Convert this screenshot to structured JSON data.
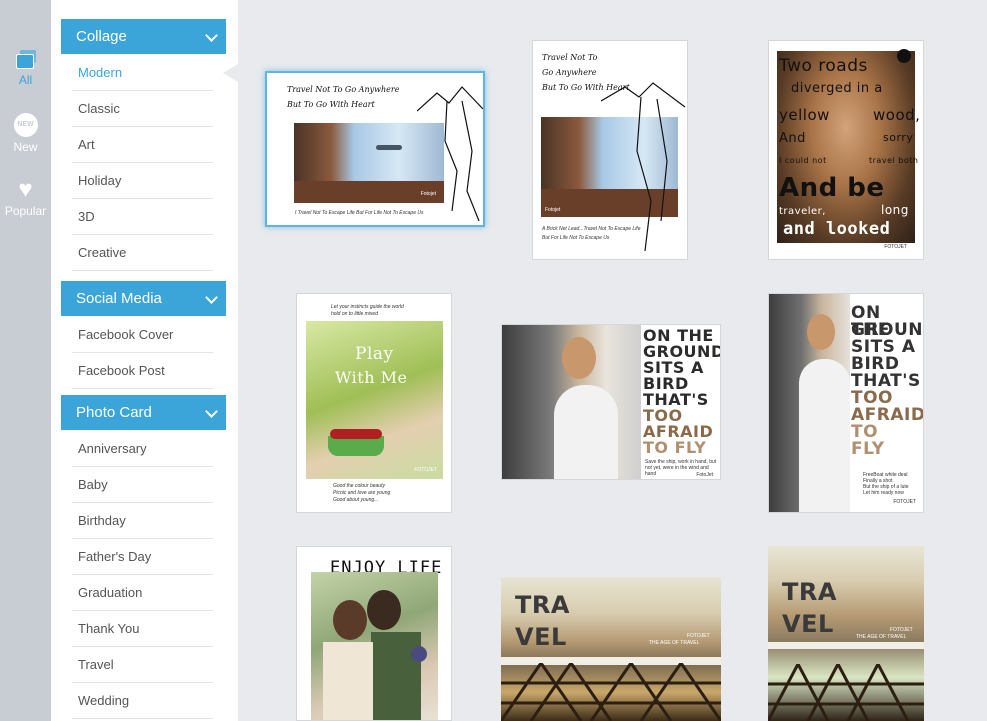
{
  "rail": {
    "items": [
      {
        "label": "All",
        "icon": "stack-icon",
        "active": true
      },
      {
        "label": "New",
        "icon": "new-badge-icon"
      },
      {
        "label": "Popular",
        "icon": "heart-icon"
      }
    ]
  },
  "categories": {
    "collage": {
      "title": "Collage",
      "items": [
        "Modern",
        "Classic",
        "Art",
        "Holiday",
        "3D",
        "Creative"
      ],
      "selected": "Modern"
    },
    "social_media": {
      "title": "Social Media",
      "items": [
        "Facebook Cover",
        "Facebook Post"
      ]
    },
    "photo_card": {
      "title": "Photo Card",
      "items": [
        "Anniversary",
        "Baby",
        "Birthday",
        "Father's Day",
        "Graduation",
        "Thank You",
        "Travel",
        "Wedding"
      ]
    }
  },
  "templates": {
    "t1": {
      "line1": "Travel Not To Go Anywhere",
      "line2": "But To Go With Heart",
      "footer": "I Travel Not To Escape Life But For Life Not To Escape Us",
      "brand": "Fotojet"
    },
    "t2": {
      "line1": "Travel Not To",
      "line2": "Go Anywhere",
      "line3": "But To Go With Heart",
      "footer1": "A Brick Net Lead...Travel Not To Escape Life",
      "footer2": "But For Life Not To Escape Us",
      "brand": "Fotojet"
    },
    "t3": {
      "line1": "Two roads",
      "line2": "diverged in a",
      "line3": "yellow",
      "line4": "wood,",
      "line5": "And",
      "line6": "sorry",
      "line7": "I could not",
      "line8": "travel both",
      "line9": "And be",
      "line10": "traveler,",
      "line11": "long",
      "line12": "and looked",
      "brand": "FOTOJET"
    },
    "t4": {
      "top1": "Let your instincts guide the world",
      "top2": "hold on to little mixed",
      "title1": "Play",
      "title2": "With Me",
      "bottom1": "Good the colour beauty",
      "bottom2": "Picnic and love are young",
      "bottom3": "Good about young...",
      "brand": "FOTOJET"
    },
    "t5": {
      "lines": [
        "ON THE",
        "GROUND",
        "SITS A",
        "BIRD",
        "THAT'S",
        "TOO",
        "AFRAID",
        "TO FLY"
      ],
      "note1": "Save the ship, work in hand, but",
      "note2": "not yet, were in the wind and hand",
      "brand": "FotoJet"
    },
    "t6": {
      "lines": [
        "ON THE",
        "GROUND",
        "SITS A",
        "BIRD",
        "THAT'S",
        "TOO",
        "AFRAID",
        "TO",
        "FLY"
      ],
      "note1": "FreeBoat white deal",
      "note2": "Finally a shot",
      "note3": "But the ship of a lute",
      "note4": "Let him ready now",
      "brand": "FOTOJET"
    },
    "t7": {
      "title": "ENJOY LIFE"
    },
    "t8": {
      "title1": "TRA",
      "title2": "VEL",
      "sub1": "FOTOJET",
      "sub2": "THE AGE OF TRAVEL"
    },
    "t9": {
      "title1": "TRA",
      "title2": "VEL",
      "sub1": "FOTOJET",
      "sub2": "THE AGE OF TRAVEL"
    }
  }
}
